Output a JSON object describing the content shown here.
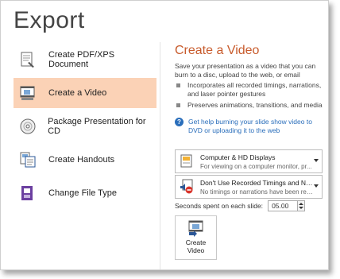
{
  "page_title": "Export",
  "menu": [
    {
      "label": "Create PDF/XPS Document",
      "icon": "pdf-xps-icon"
    },
    {
      "label": "Create a Video",
      "icon": "video-icon",
      "active": true
    },
    {
      "label": "Package Presentation for CD",
      "icon": "cd-icon"
    },
    {
      "label": "Create Handouts",
      "icon": "handouts-icon"
    },
    {
      "label": "Change File Type",
      "icon": "file-type-icon"
    }
  ],
  "panel": {
    "title": "Create a Video",
    "description": "Save your presentation as a video that you can burn to a disc, upload to the web, or email",
    "bullets": [
      "Incorporates all recorded timings, narrations, and laser pointer gestures",
      "Preserves animations, transitions, and media"
    ],
    "help_link": "Get help burning your slide show video to DVD or uploading it to the web",
    "quality_dropdown": {
      "title": "Computer & HD Displays",
      "subtitle": "For viewing on a computer monitor, pr..."
    },
    "timings_dropdown": {
      "title": "Don't Use Recorded Timings and Narra...",
      "subtitle": "No timings or narrations have been rec..."
    },
    "seconds_label": "Seconds spent on each slide:",
    "seconds_value": "05.00",
    "create_button_line1": "Create",
    "create_button_line2": "Video"
  },
  "colors": {
    "accent": "#c85b2c",
    "selected_bg": "#fbd2b6",
    "link": "#2a6ebb"
  }
}
